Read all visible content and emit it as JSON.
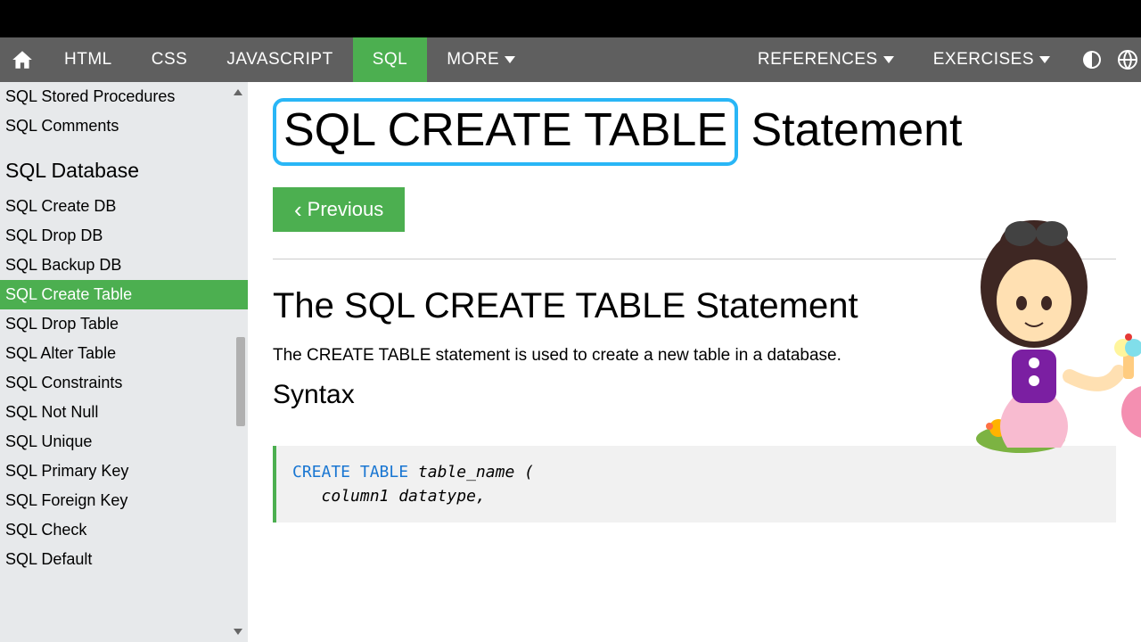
{
  "topnav": {
    "items": [
      "HTML",
      "CSS",
      "JAVASCRIPT",
      "SQL"
    ],
    "more": "MORE",
    "references": "REFERENCES",
    "exercises": "EXERCISES"
  },
  "sidebar": {
    "top_items": [
      "SQL Stored Procedures",
      "SQL Comments"
    ],
    "heading": "SQL Database",
    "db_items": [
      "SQL Create DB",
      "SQL Drop DB",
      "SQL Backup DB",
      "SQL Create Table",
      "SQL Drop Table",
      "SQL Alter Table",
      "SQL Constraints",
      "SQL Not Null",
      "SQL Unique",
      "SQL Primary Key",
      "SQL Foreign Key",
      "SQL Check",
      "SQL Default"
    ],
    "active_index": 3
  },
  "main": {
    "title_highlight": "SQL CREATE TABLE",
    "title_rest": " Statement",
    "prev_label": "Previous",
    "section_title": "The SQL CREATE TABLE Statement",
    "desc": "The CREATE TABLE statement is used to create a new table in a database.",
    "syntax_label": "Syntax",
    "code": {
      "kw1": "CREATE",
      "kw2": "TABLE",
      "ident": "table_name (",
      "line2": "column1 datatype,"
    }
  }
}
